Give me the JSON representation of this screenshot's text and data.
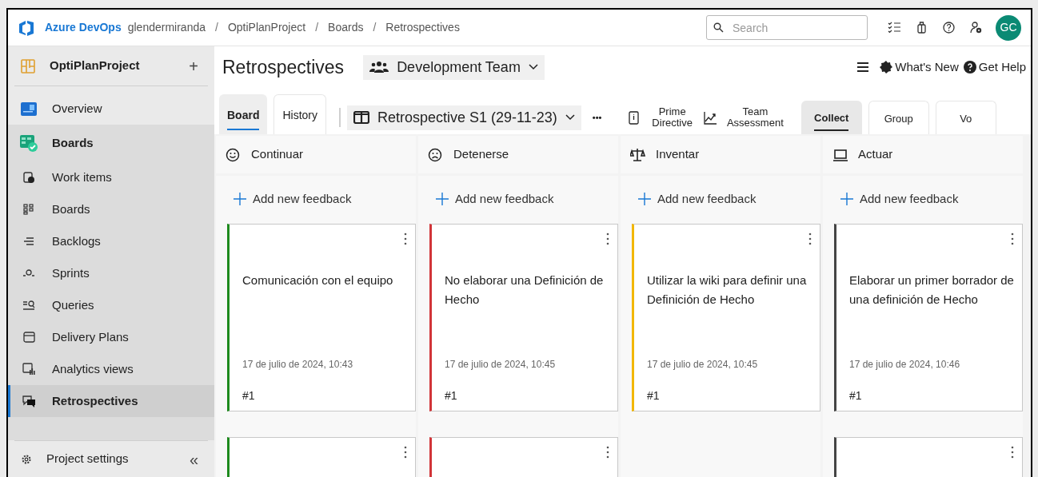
{
  "header": {
    "brand": "Azure DevOps",
    "breadcrumbs": [
      "glendermiranda",
      "OptiPlanProject",
      "Boards",
      "Retrospectives"
    ],
    "separator": "/",
    "search": {
      "placeholder": "Search"
    },
    "avatar": "GC"
  },
  "sidebar": {
    "project": "OptiPlanProject",
    "add": "+",
    "items": [
      {
        "label": "Overview",
        "selected": false
      },
      {
        "label": "Boards",
        "selected": false,
        "children": [
          {
            "label": "Work items",
            "selected": false
          },
          {
            "label": "Boards",
            "selected": false
          },
          {
            "label": "Backlogs",
            "selected": false
          },
          {
            "label": "Sprints",
            "selected": false
          },
          {
            "label": "Queries",
            "selected": false
          },
          {
            "label": "Delivery Plans",
            "selected": false
          },
          {
            "label": "Analytics views",
            "selected": false
          },
          {
            "label": "Retrospectives",
            "selected": true
          }
        ]
      }
    ],
    "footer": {
      "label": "Project settings",
      "collapse": "«"
    }
  },
  "page": {
    "title": "Retrospectives",
    "team": "Development Team",
    "links": [
      "What's New",
      "Get Help"
    ]
  },
  "view_tabs": [
    {
      "label": "Board",
      "selected": true
    },
    {
      "label": "History",
      "selected": false
    }
  ],
  "board_selector": "Retrospective S1 (29-11-23)",
  "more": "•••",
  "actions": [
    "Prime\nDirective",
    "Team\nAssessment"
  ],
  "phase_tabs": [
    {
      "label": "Collect",
      "selected": true
    },
    {
      "label": "Group",
      "selected": false
    },
    {
      "label": "Vo",
      "selected": false
    }
  ],
  "columns": [
    {
      "title": "Continuar",
      "color": "#1e8a1e",
      "add": "Add new feedback",
      "cards": [
        {
          "kind": "full",
          "text": "Comunicación con el equipo",
          "date": "17 de julio de 2024, 10:43",
          "number": "#1"
        },
        {
          "kind": "partial"
        }
      ]
    },
    {
      "title": "Detenerse",
      "color": "#d13438",
      "add": "Add new feedback",
      "cards": [
        {
          "kind": "full",
          "text": "No elaborar una Definición de Hecho",
          "date": "17 de julio de 2024, 10:45",
          "number": "#1"
        },
        {
          "kind": "partial"
        }
      ]
    },
    {
      "title": "Inventar",
      "color": "#f2b705",
      "add": "Add new feedback",
      "cards": [
        {
          "kind": "full",
          "text": "Utilizar la wiki para definir una Definición de Hecho",
          "date": "17 de julio de 2024, 10:45",
          "number": "#1"
        }
      ]
    },
    {
      "title": "Actuar",
      "color": "#444444",
      "add": "Add new feedback",
      "cards": [
        {
          "kind": "full",
          "text": "Elaborar un primer borrador de una definición de Hecho",
          "date": "17 de julio de 2024, 10:46",
          "number": "#1"
        },
        {
          "kind": "partial"
        }
      ]
    }
  ]
}
